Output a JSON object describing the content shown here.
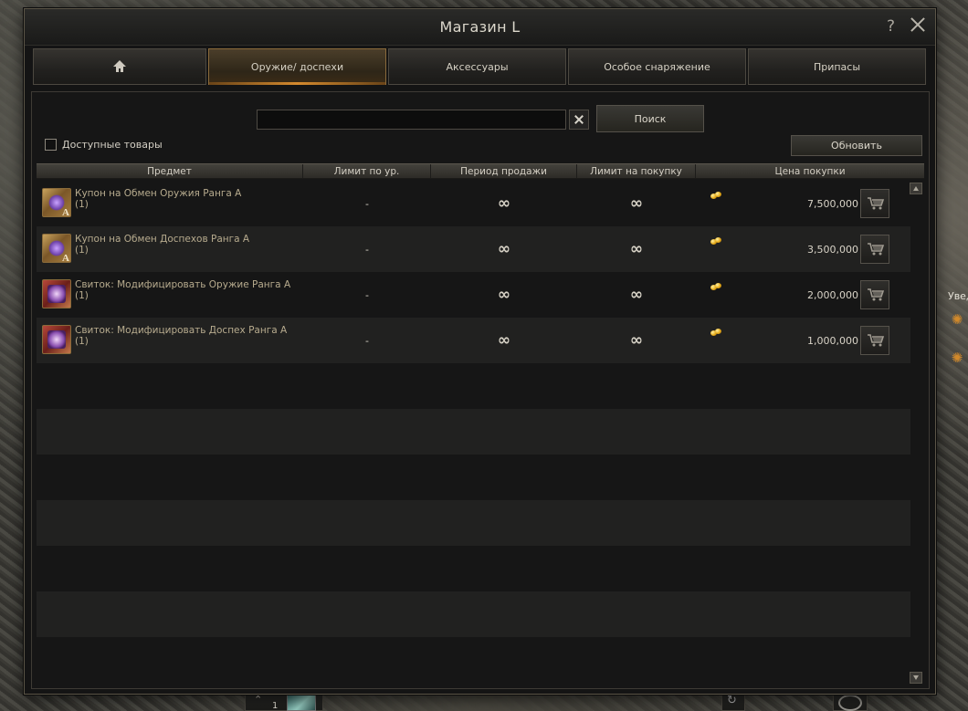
{
  "window": {
    "title": "Магазин L"
  },
  "tabs": {
    "home_icon": "home-icon",
    "items": [
      {
        "label": "Оружие/ доспехи"
      },
      {
        "label": "Аксессуары"
      },
      {
        "label": "Особое снаряжение"
      },
      {
        "label": "Припасы"
      }
    ]
  },
  "search": {
    "value": "",
    "placeholder": "",
    "button_label": "Поиск"
  },
  "filter": {
    "available_label": "Доступные товары",
    "checked": false
  },
  "refresh_label": "Обновить",
  "table": {
    "headers": [
      "Предмет",
      "Лимит по ур.",
      "Период продажи",
      "Лимит на покупку",
      "Цена покупки"
    ],
    "rows": [
      {
        "name": "Купон на Обмен Оружия Ранга А",
        "count": "(1)",
        "level_limit": "-",
        "sale_period": "∞",
        "purchase_limit": "∞",
        "price": "7,500,000",
        "icon": "weapon-coupon-icon"
      },
      {
        "name": "Купон на Обмен Доспехов Ранга А",
        "count": "(1)",
        "level_limit": "-",
        "sale_period": "∞",
        "purchase_limit": "∞",
        "price": "3,500,000",
        "icon": "armor-coupon-icon"
      },
      {
        "name": "Свиток: Модифицировать Оружие Ранга А",
        "count": "(1)",
        "level_limit": "-",
        "sale_period": "∞",
        "purchase_limit": "∞",
        "price": "2,000,000",
        "icon": "weapon-scroll-icon"
      },
      {
        "name": "Свиток: Модифицировать Доспех Ранга А",
        "count": "(1)",
        "level_limit": "-",
        "sale_period": "∞",
        "purchase_limit": "∞",
        "price": "1,000,000",
        "icon": "armor-scroll-icon"
      }
    ]
  },
  "side": {
    "note": "Увед"
  },
  "bottom": {
    "slot_number": "1"
  },
  "colors": {
    "accent": "#d48a2e",
    "item_text": "#b7ab8e",
    "background": "#141414"
  }
}
